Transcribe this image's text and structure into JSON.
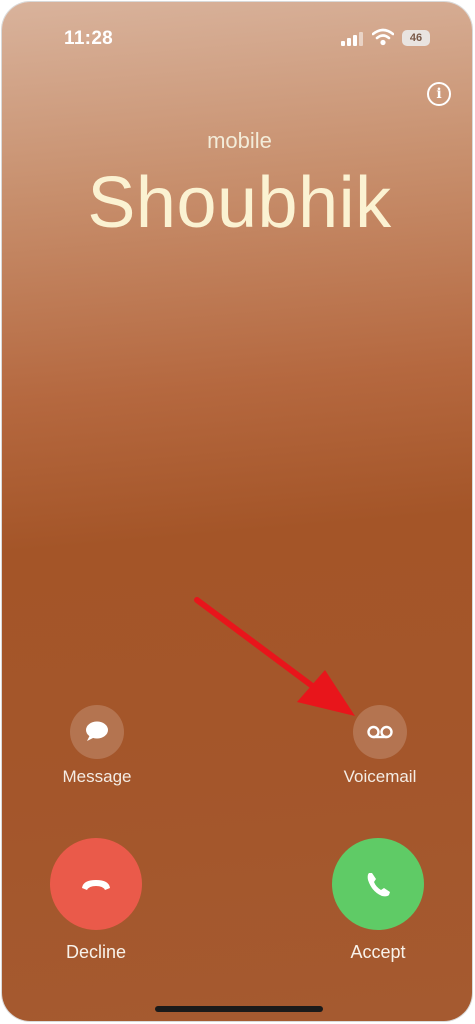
{
  "status_bar": {
    "time": "11:28",
    "battery": "46",
    "icons": [
      "cellular-signal-icon",
      "wifi-icon",
      "battery-icon"
    ]
  },
  "call": {
    "label": "mobile",
    "caller_name": "Shoubhik"
  },
  "actions": {
    "message_label": "Message",
    "voicemail_label": "Voicemail",
    "decline_label": "Decline",
    "accept_label": "Accept"
  },
  "colors": {
    "decline": "#ea5a4a",
    "accept": "#5fcb66",
    "annotation_arrow": "#e8151b"
  }
}
